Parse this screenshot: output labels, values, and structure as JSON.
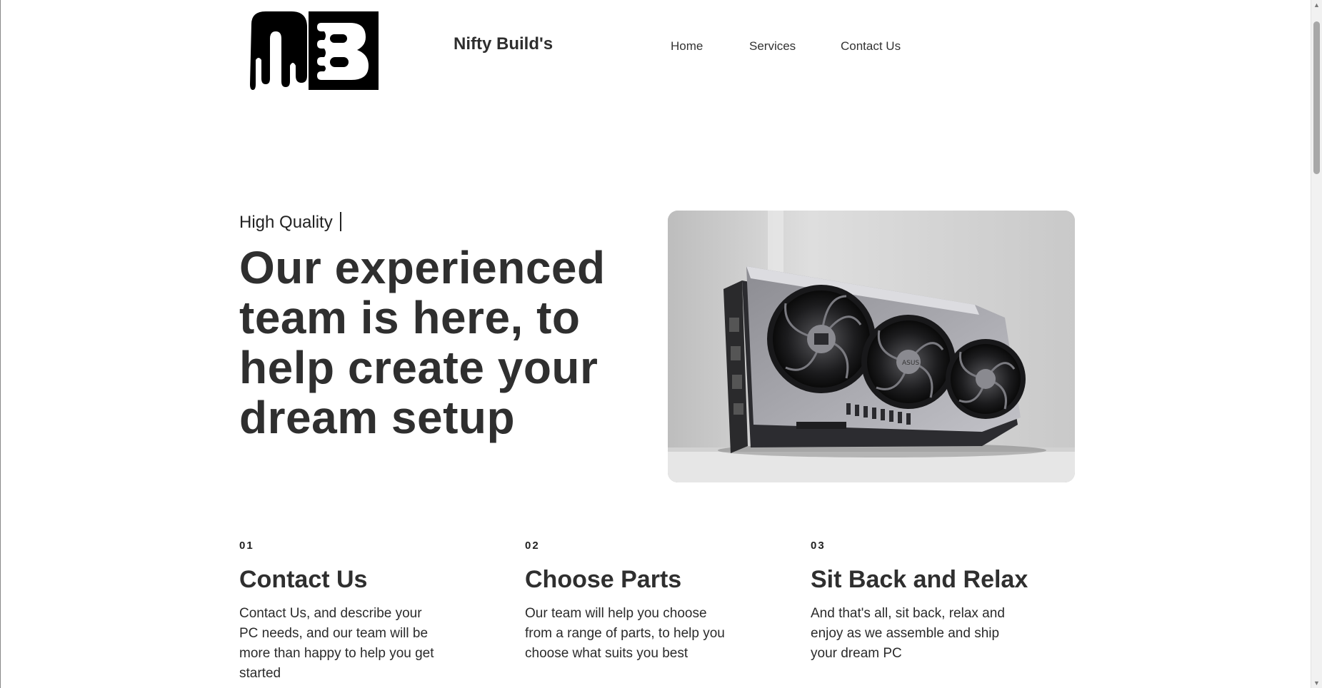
{
  "header": {
    "brand": "Nifty Build's",
    "logo": {
      "monogram": "NB",
      "caption": "NIFTY BUILDS"
    },
    "nav": [
      "Home",
      "Services",
      "Contact Us"
    ]
  },
  "hero": {
    "tagline": "High Quality",
    "title": "Our experienced team is here, to help create your dream setup",
    "image": {
      "subject": "graphics-card-photo",
      "badge": "ASUS"
    }
  },
  "steps": [
    {
      "num": "01",
      "title": "Contact Us",
      "text": "Contact Us, and describe your PC needs, and our team will be more than happy to help you get started"
    },
    {
      "num": "02",
      "title": "Choose Parts",
      "text": "Our team will help you choose from a range of parts, to help you choose what suits you best"
    },
    {
      "num": "03",
      "title": "Sit Back and Relax",
      "text": "And that's all, sit back, relax and enjoy as we assemble and ship your dream PC"
    }
  ],
  "colors": {
    "text": "#2f2f2f",
    "background": "#ffffff",
    "logo": "#000000"
  }
}
